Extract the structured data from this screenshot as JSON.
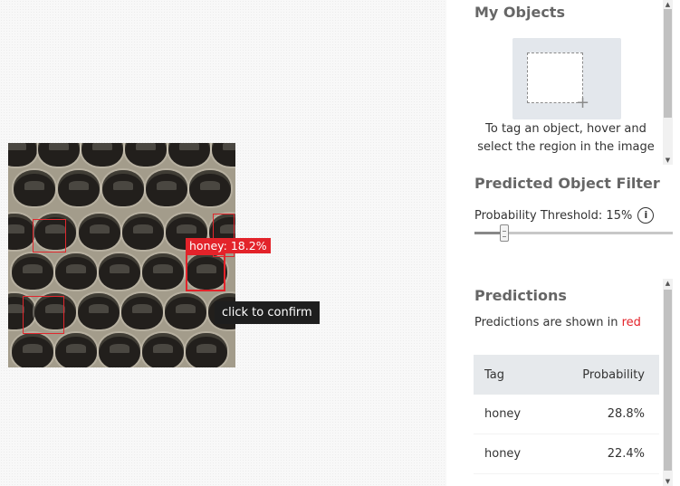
{
  "image_area": {
    "hover_box_label": "honey: 18.2%",
    "tooltip": "click to confirm"
  },
  "panel": {
    "my_objects": {
      "title": "My Objects",
      "hint_line1": "To tag an object, hover and",
      "hint_line2": "select the region in the image"
    },
    "filter": {
      "title": "Predicted Object Filter",
      "threshold_label": "Probability Threshold: 15%",
      "threshold_value": 0.15
    },
    "predictions": {
      "title": "Predictions",
      "note_prefix": "Predictions are shown in ",
      "note_color_word": "red",
      "columns": [
        "Tag",
        "Probability"
      ],
      "rows": [
        {
          "tag": "honey",
          "probability": "28.8%"
        },
        {
          "tag": "honey",
          "probability": "22.4%"
        }
      ]
    }
  },
  "colors": {
    "prediction_red": "#e3232a",
    "table_header_bg": "#e6e9ec"
  },
  "icons": [
    "plus-icon",
    "info-icon",
    "scroll-up-icon",
    "scroll-down-icon"
  ]
}
